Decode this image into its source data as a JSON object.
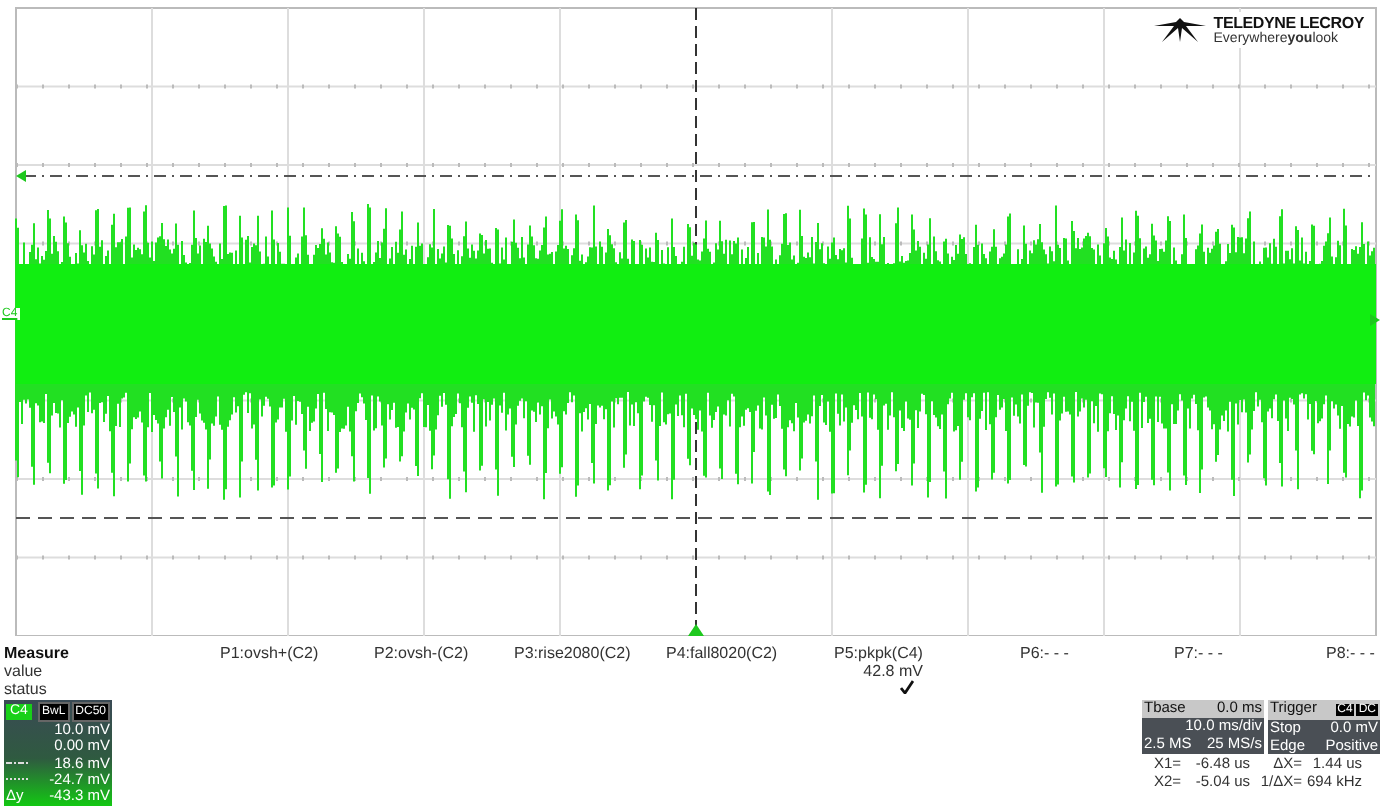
{
  "logo": {
    "brand": "TELEDYNE LECROY",
    "tagline": "Everywhere**you**look"
  },
  "scope": {
    "channel_label": "C4"
  },
  "measure": {
    "header": "Measure",
    "row_labels": [
      "value",
      "status"
    ],
    "params": [
      {
        "label": "P1:ovsh+(C2)",
        "status_ok": false
      },
      {
        "label": "P2:ovsh-(C2)",
        "status_ok": false
      },
      {
        "label": "P3:rise2080(C2)",
        "status_ok": false
      },
      {
        "label": "P4:fall8020(C2)",
        "status_ok": false
      },
      {
        "label": "P5:pkpk(C4)",
        "value": "42.8 mV",
        "status_ok": true
      },
      {
        "label": "P6:- - -",
        "status_ok": false
      },
      {
        "label": "P7:- - -",
        "status_ok": false
      },
      {
        "label": "P8:- - -",
        "status_ok": false
      }
    ]
  },
  "channel_box": {
    "name": "C4",
    "tags": [
      "BwL",
      "DC50"
    ],
    "rows": [
      {
        "kind": "plain",
        "value": "10.0 mV"
      },
      {
        "kind": "plain",
        "value": "0.00 mV"
      },
      {
        "kind": "dashdot",
        "value": "18.6 mV"
      },
      {
        "kind": "dotted",
        "value": "-24.7 mV"
      },
      {
        "kind": "delta",
        "label": "Δy",
        "value": "-43.3 mV"
      }
    ]
  },
  "timebase": {
    "label": "Tbase",
    "delay": "0.0 ms",
    "scale": "10.0 ms/div",
    "samples": "2.5 MS",
    "rate": "25 MS/s"
  },
  "trigger": {
    "label": "Trigger",
    "source": "C4",
    "coupling": "DC",
    "mode": "Stop",
    "level": "0.0 mV",
    "type": "Edge",
    "slope": "Positive"
  },
  "cursors": [
    {
      "label": "X1=",
      "value": "-6.48 us",
      "dlabel": "ΔX=",
      "dvalue": "1.44 us"
    },
    {
      "label": "X2=",
      "value": "-5.04 us",
      "dlabel": "1/ΔX=",
      "dvalue": "694 kHz"
    }
  ]
}
